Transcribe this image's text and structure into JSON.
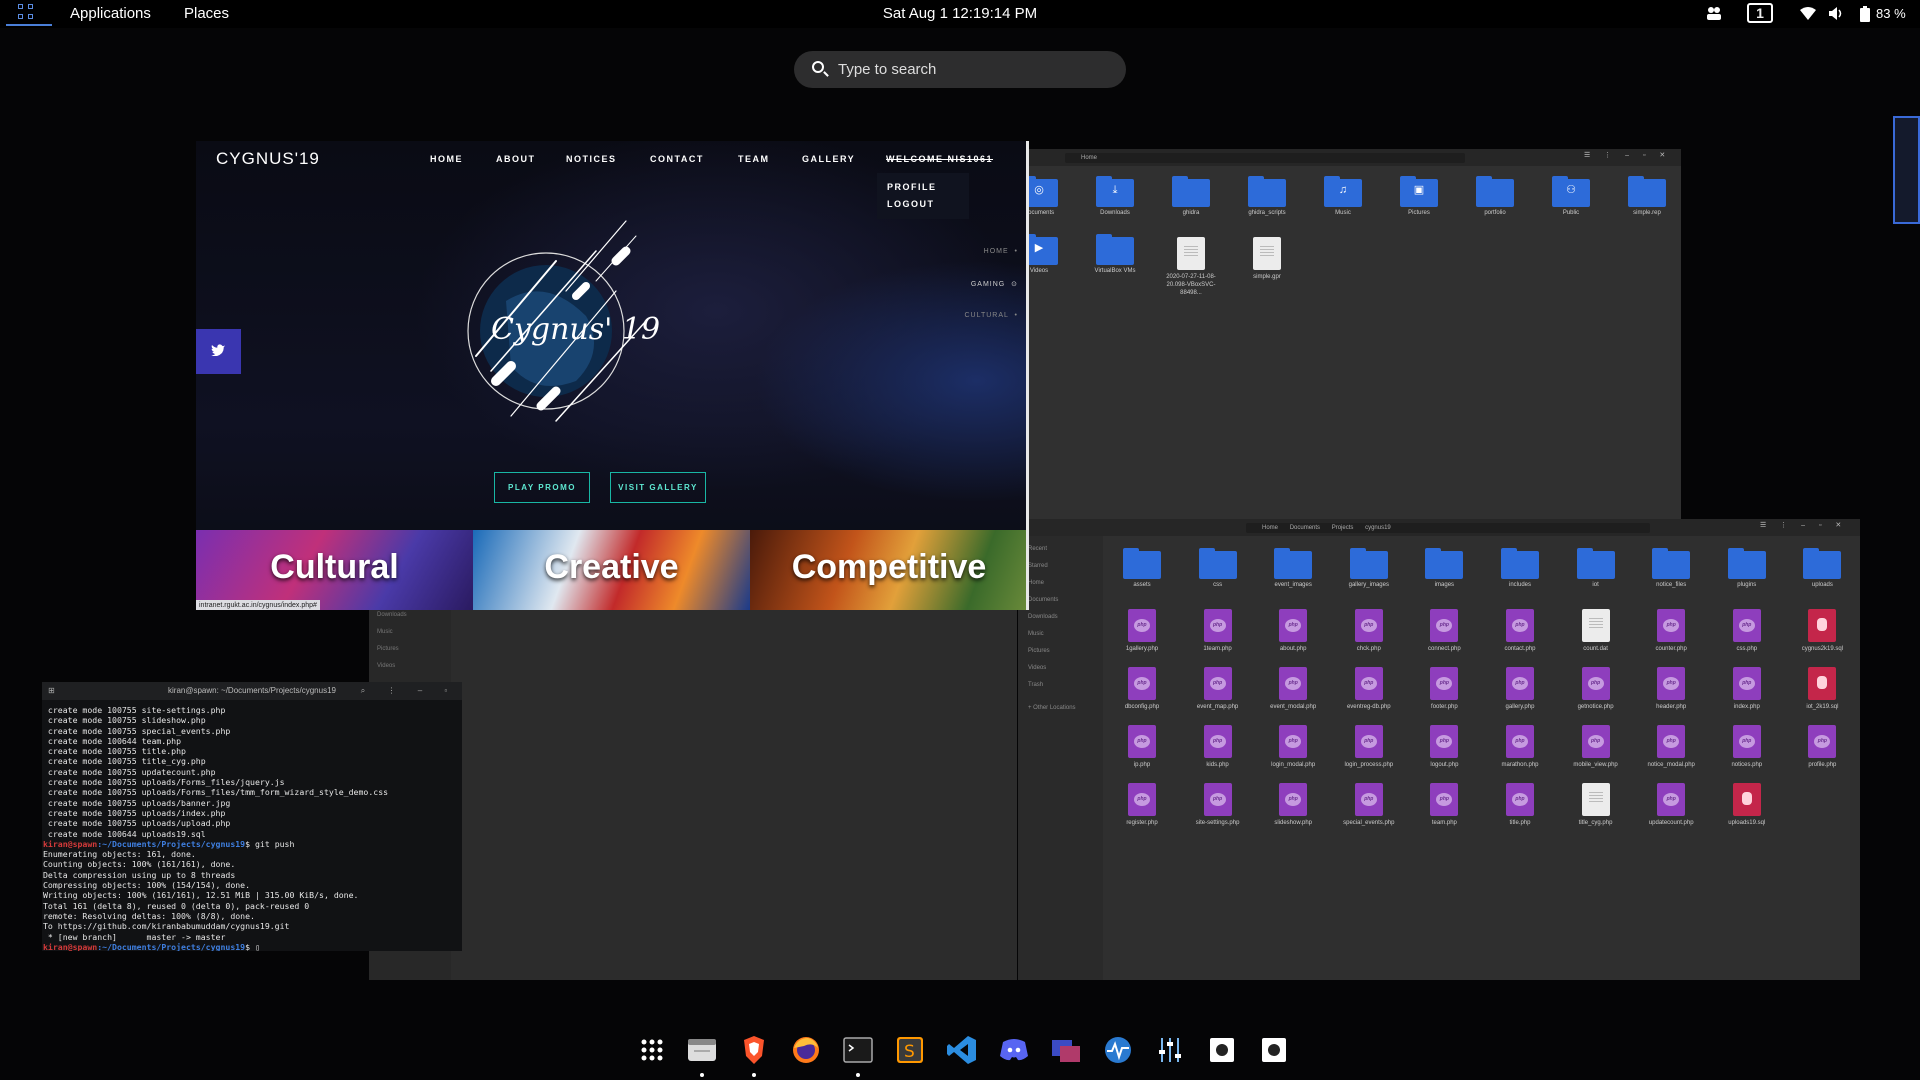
{
  "topbar": {
    "activities": "Applications",
    "places": "Places",
    "clock": "Sat Aug 1  12:19:14 PM",
    "workspace": "1",
    "battery": "83 %"
  },
  "search": {
    "placeholder": "Type to search"
  },
  "browser": {
    "site_logo": "CYGNUS'19",
    "nav": [
      "HOME",
      "ABOUT",
      "NOTICES",
      "CONTACT",
      "TEAM",
      "GALLERY",
      "WELCOME NIS1061"
    ],
    "user_menu": [
      "PROFILE",
      "LOGOUT"
    ],
    "hero_title": "Cygnus' 19",
    "side_nav": [
      "HOME",
      "GAMING",
      "CULTURAL"
    ],
    "buttons": {
      "promo": "PLAY PROMO",
      "gallery": "VISIT GALLERY"
    },
    "categories": [
      "Cultural",
      "Creative",
      "Competitive"
    ],
    "status_url": "intranet.rgukt.ac.in/cygnus/index.php#"
  },
  "fm_home": {
    "path": "Home",
    "items": [
      {
        "label": "Documents",
        "icon": "folder-doc"
      },
      {
        "label": "Downloads",
        "icon": "folder-download"
      },
      {
        "label": "ghidra",
        "icon": "folder"
      },
      {
        "label": "ghidra_scripts",
        "icon": "folder"
      },
      {
        "label": "Music",
        "icon": "folder-music"
      },
      {
        "label": "Pictures",
        "icon": "folder-picture"
      },
      {
        "label": "portfolio",
        "icon": "folder"
      },
      {
        "label": "Public",
        "icon": "folder-public"
      },
      {
        "label": "simple.rep",
        "icon": "folder"
      },
      {
        "label": "Videos",
        "icon": "folder-video"
      },
      {
        "label": "VirtualBox VMs",
        "icon": "folder"
      },
      {
        "label": "2020-07-27-11-08-20.098-VBoxSVC-88498...",
        "icon": "doc"
      },
      {
        "label": "simple.gpr",
        "icon": "doc"
      }
    ]
  },
  "fm_project": {
    "breadcrumb": [
      "Home",
      "Documents",
      "Projects",
      "cygnus19"
    ],
    "sidebar": [
      "Recent",
      "Starred",
      "Home",
      "Documents",
      "Downloads",
      "Music",
      "Pictures",
      "Videos",
      "Trash",
      "+ Other Locations"
    ],
    "folders": [
      "assets",
      "css",
      "event_images",
      "gallery_images",
      "images",
      "includes",
      "iot",
      "notice_files",
      "plugins",
      "uploads"
    ],
    "files": [
      {
        "name": "1gallery.php",
        "type": "php"
      },
      {
        "name": "1team.php",
        "type": "php"
      },
      {
        "name": "about.php",
        "type": "php"
      },
      {
        "name": "chck.php",
        "type": "php"
      },
      {
        "name": "connect.php",
        "type": "php"
      },
      {
        "name": "contact.php",
        "type": "php"
      },
      {
        "name": "count.dat",
        "type": "doc"
      },
      {
        "name": "counter.php",
        "type": "php"
      },
      {
        "name": "css.php",
        "type": "php"
      },
      {
        "name": "cygnus2k19.sql",
        "type": "sql"
      },
      {
        "name": "dbconfig.php",
        "type": "php"
      },
      {
        "name": "event_map.php",
        "type": "php"
      },
      {
        "name": "event_modal.php",
        "type": "php"
      },
      {
        "name": "eventreg-db.php",
        "type": "php"
      },
      {
        "name": "footer.php",
        "type": "php"
      },
      {
        "name": "gallery.php",
        "type": "php"
      },
      {
        "name": "getnotice.php",
        "type": "php"
      },
      {
        "name": "header.php",
        "type": "php"
      },
      {
        "name": "index.php",
        "type": "php"
      },
      {
        "name": "iot_2k19.sql",
        "type": "sql"
      },
      {
        "name": "ip.php",
        "type": "php"
      },
      {
        "name": "kids.php",
        "type": "php"
      },
      {
        "name": "login_modal.php",
        "type": "php"
      },
      {
        "name": "login_process.php",
        "type": "php"
      },
      {
        "name": "logout.php",
        "type": "php"
      },
      {
        "name": "marathon.php",
        "type": "php"
      },
      {
        "name": "mobile_view.php",
        "type": "php"
      },
      {
        "name": "notice_modal.php",
        "type": "php"
      },
      {
        "name": "notices.php",
        "type": "php"
      },
      {
        "name": "profile.php",
        "type": "php"
      },
      {
        "name": "register.php",
        "type": "php"
      },
      {
        "name": "site-settings.php",
        "type": "php"
      },
      {
        "name": "slideshow.php",
        "type": "php"
      },
      {
        "name": "special_events.php",
        "type": "php"
      },
      {
        "name": "team.php",
        "type": "php"
      },
      {
        "name": "title.php",
        "type": "php"
      },
      {
        "name": "title_cyg.php",
        "type": "doc"
      },
      {
        "name": "updatecount.php",
        "type": "php"
      },
      {
        "name": "uploads19.sql",
        "type": "sql"
      }
    ]
  },
  "fm_back_sidebar": [
    "Downloads",
    "Music",
    "Pictures",
    "Videos"
  ],
  "terminal": {
    "title": "kiran@spawn: ~/Documents/Projects/cygnus19",
    "lines": [
      " create mode 100755 site-settings.php",
      " create mode 100755 slideshow.php",
      " create mode 100755 special_events.php",
      " create mode 100644 team.php",
      " create mode 100755 title.php",
      " create mode 100755 title_cyg.php",
      " create mode 100755 updatecount.php",
      " create mode 100755 uploads/Forms_files/jquery.js",
      " create mode 100755 uploads/Forms_files/tmm_form_wizard_style_demo.css",
      " create mode 100755 uploads/banner.jpg",
      " create mode 100755 uploads/index.php",
      " create mode 100755 uploads/upload.php",
      " create mode 100644 uploads19.sql"
    ],
    "prompt_user": "kiran@spawn",
    "prompt_path": ":~/Documents/Projects/cygnus19",
    "command": "$ git push",
    "output": [
      "Enumerating objects: 161, done.",
      "Counting objects: 100% (161/161), done.",
      "Delta compression using up to 8 threads",
      "Compressing objects: 100% (154/154), done.",
      "Writing objects: 100% (161/161), 12.51 MiB | 315.00 KiB/s, done.",
      "Total 161 (delta 8), reused 0 (delta 0), pack-reused 0",
      "remote: Resolving deltas: 100% (8/8), done.",
      "To https://github.com/kiranbabumuddam/cygnus19.git",
      " * [new branch]      master -> master"
    ],
    "final_prompt_end": "$ "
  },
  "dock": [
    "app-grid",
    "files",
    "brave",
    "firefox",
    "terminal",
    "sublime-text",
    "vscode",
    "discord",
    "remote-desktop",
    "system-monitor",
    "settings-tweaks",
    "screenshot",
    "screenshot-2"
  ],
  "colors": {
    "accent": "#4a7fd8",
    "folder": "#2d6bd9",
    "php": "#8e3ebd",
    "sql": "#c4264a",
    "teal": "#19b6a4"
  }
}
